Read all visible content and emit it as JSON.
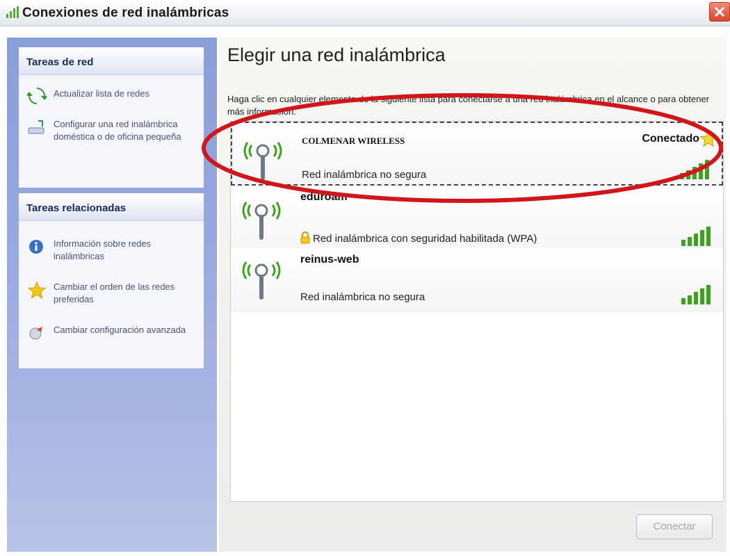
{
  "window": {
    "title": "Conexiones de red inalámbricas"
  },
  "left_pane": {
    "network_tasks": {
      "header": "Tareas de red",
      "items": [
        {
          "label": "Actualizar lista de redes",
          "icon": "refresh-icon"
        },
        {
          "label": "Configurar una red inalámbrica doméstica o de oficina pequeña",
          "icon": "wizard-icon"
        }
      ]
    },
    "related_tasks": {
      "header": "Tareas relacionadas",
      "items": [
        {
          "label": "Información sobre redes inalámbricas",
          "icon": "info-icon"
        },
        {
          "label": "Cambiar el orden de las redes preferidas",
          "icon": "star-icon"
        },
        {
          "label": "Cambiar configuración avanzada",
          "icon": "settings-icon"
        }
      ]
    }
  },
  "main": {
    "title": "Elegir una red inalámbrica",
    "instructions": "Haga clic en cualquier elemento de la siguiente lista para conectarse a una red inalámbrica en el alcance o para obtener más información.",
    "networks": [
      {
        "ssid": "COLMENAR WIRELESS",
        "status": "Red inalámbrica no segura",
        "connection": "Conectado",
        "secured": false,
        "signal_bars": 5,
        "selected": true
      },
      {
        "ssid": "eduroam",
        "status": "Red inalámbrica con seguridad habilitada (WPA)",
        "secured": true,
        "signal_bars": 5,
        "selected": false
      },
      {
        "ssid": "reinus-web",
        "status": "Red inalámbrica no segura",
        "secured": false,
        "signal_bars": 5,
        "selected": false
      }
    ],
    "connect_button": "Conectar"
  },
  "colors": {
    "highlight_ellipse": "#d0161a",
    "pane_blue": "#8a9ed8",
    "signal_green": "#3ea21e"
  }
}
